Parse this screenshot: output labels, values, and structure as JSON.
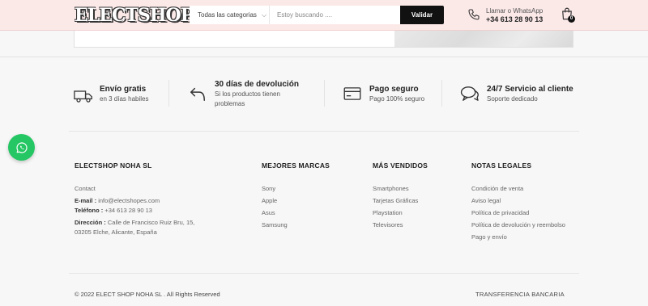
{
  "header": {
    "logo_text": "ELECTSHOP",
    "category_select": "Todas las categorias",
    "search_placeholder": "Estoy buscando ....",
    "search_button": "Validar",
    "call_label": "Llamar o WhatsApp",
    "call_number": "+34 613 28 90 13",
    "cart_count": "0"
  },
  "features": [
    {
      "title": "Envío gratis",
      "desc_1": "en 3 días habiles",
      "icon": "truck-icon"
    },
    {
      "title": "30 días de devolución",
      "desc_1": "Si los productos tienen",
      "desc_2": "problemas",
      "icon": "return-arrow-icon"
    },
    {
      "title": "Pago seguro",
      "desc_1": "Pago 100% seguro",
      "icon": "card-icon"
    },
    {
      "title": "24/7 Servicio al cliente",
      "desc_1": "Soporte dedicado",
      "icon": "chat-icon"
    }
  ],
  "footer": {
    "company": {
      "title": "ELECTSHOP NOHA SL",
      "contact": "Contact",
      "email_label": "E-mail :",
      "email_value": "info@electshopes.com",
      "phone_label": "Teléfono :",
      "phone_value": "+34 613 28 90 13",
      "address_label": "Dirección :",
      "address_line1": "Calle de Francisco Ruiz Bru, 15,",
      "address_line2": "03205 Elche, Alicante, España"
    },
    "brands": {
      "title": "MEJORES MARCAS",
      "items": [
        "Sony",
        "Apple",
        "Asus",
        "Samsung"
      ]
    },
    "bestsellers": {
      "title": "MÁS VENDIDOS",
      "items": [
        "Smartphones",
        "Tarjetas Gráficas",
        "Playstation",
        "Televisores"
      ]
    },
    "legal": {
      "title": "NOTAS LEGALES",
      "items": [
        "Condición de venta",
        "Aviso legal",
        "Política de privacidad",
        "Política de devolución y reembolso",
        "Pago y envío"
      ]
    },
    "copyright": "© 2022 ELECT SHOP NOHA SL . All Rights Reserved",
    "payment": "TRANSFERENCIA BANCARIA"
  },
  "colors": {
    "header_bg": "#fbe9e8",
    "page_bg": "#f7f7f7",
    "whatsapp": "#25c664",
    "button_bg": "#111111"
  }
}
